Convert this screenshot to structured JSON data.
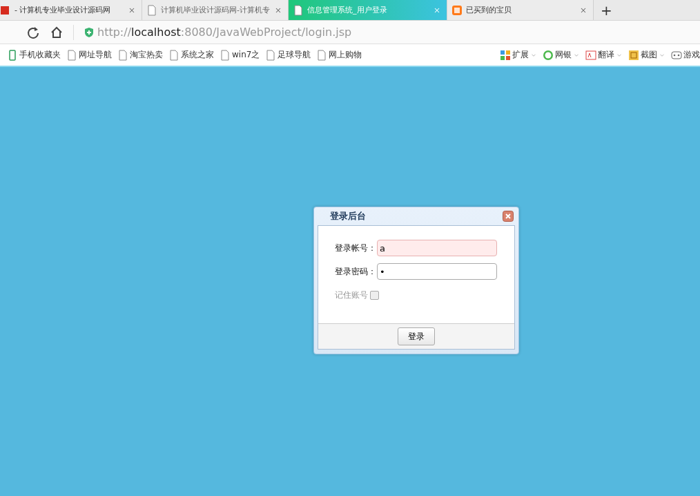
{
  "tabs": [
    {
      "title": "- 计算机专业毕业设计源码网",
      "kind": "site",
      "selected": false
    },
    {
      "title": "计算机毕业设计源码网-计算机专",
      "kind": "page",
      "selected": false
    },
    {
      "title": "信息管理系统_用户登录",
      "kind": "page",
      "selected": true
    },
    {
      "title": "已买到的宝贝",
      "kind": "taobao",
      "selected": false
    }
  ],
  "new_tab": "+",
  "address_bar": {
    "scheme": "http://",
    "host": "localhost",
    "rest": ":8080/JavaWebProject/login.jsp"
  },
  "bookmarks": [
    {
      "label": "手机收藏夹",
      "kind": "phone"
    },
    {
      "label": "网址导航",
      "kind": "page"
    },
    {
      "label": "淘宝热卖",
      "kind": "page"
    },
    {
      "label": "系统之家",
      "kind": "page"
    },
    {
      "label": "win7之",
      "kind": "page"
    },
    {
      "label": "足球导航",
      "kind": "page"
    },
    {
      "label": "网上购物",
      "kind": "page"
    }
  ],
  "tools": [
    {
      "label": "扩展",
      "kind": "grid",
      "dropdown": true
    },
    {
      "label": "网银",
      "kind": "coin",
      "dropdown": true
    },
    {
      "label": "翻译",
      "kind": "translate",
      "dropdown": true
    },
    {
      "label": "截图",
      "kind": "scissors",
      "dropdown": true
    },
    {
      "label": "游戏",
      "kind": "gamepad",
      "dropdown": false
    }
  ],
  "dialog": {
    "title": "登录后台",
    "fields": [
      {
        "label": "登录帐号：",
        "value": "a",
        "invalid": true
      },
      {
        "label": "登录密码：",
        "value": "•",
        "invalid": false
      }
    ],
    "remember": {
      "label": "记住账号",
      "checked": false
    },
    "button": "登录"
  }
}
